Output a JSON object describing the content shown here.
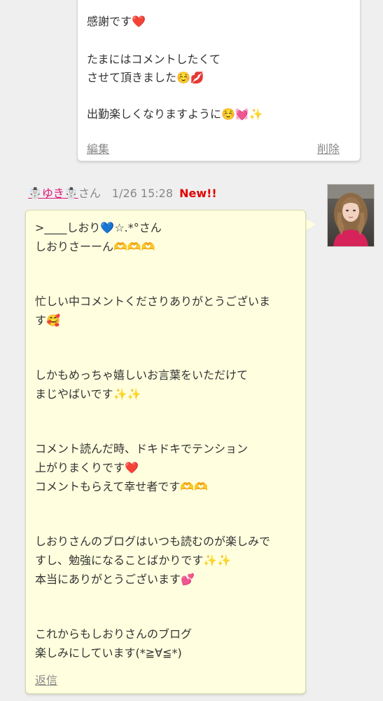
{
  "previous_comment": {
    "lines": [
      "感謝です❤️",
      "たまにはコメントしたくて",
      "させて頂きました☺️💋",
      "出勤楽しくなりますように☺️💓✨"
    ],
    "edit_label": "編集",
    "delete_label": "削除"
  },
  "reply": {
    "author_name": "☃️ゆき☃️",
    "author_suffix": "さん",
    "datetime": "1/26 15:28",
    "new_badge": "New!!",
    "avatar_icon": "user-photo-icon",
    "lines": [
      ">____しおり💙☆.*°さん",
      "しおりさーーん🫶🫶🫶",
      "忙しい中コメントくださりありがとうございま",
      "す🥰",
      "しかもめっちゃ嬉しいお言葉をいただけて",
      "まじやばいです✨✨",
      "コメント読んだ時、ドキドキでテンション",
      "上がりまくりです❤️",
      "コメントもらえて幸せ者です🫶🫶",
      "しおりさんのブログはいつも読むのが楽しみで",
      "すし、勉強になることばかりです✨✨",
      "本当にありがとうございます💕",
      "これからもしおりさんのブログ",
      "楽しみにしています(*≧∀≦*)"
    ],
    "reply_label": "返信"
  },
  "colors": {
    "background": "#efefef",
    "bubble": "#ffffdf",
    "author_link": "#e0187a",
    "new_badge": "#e00000"
  }
}
